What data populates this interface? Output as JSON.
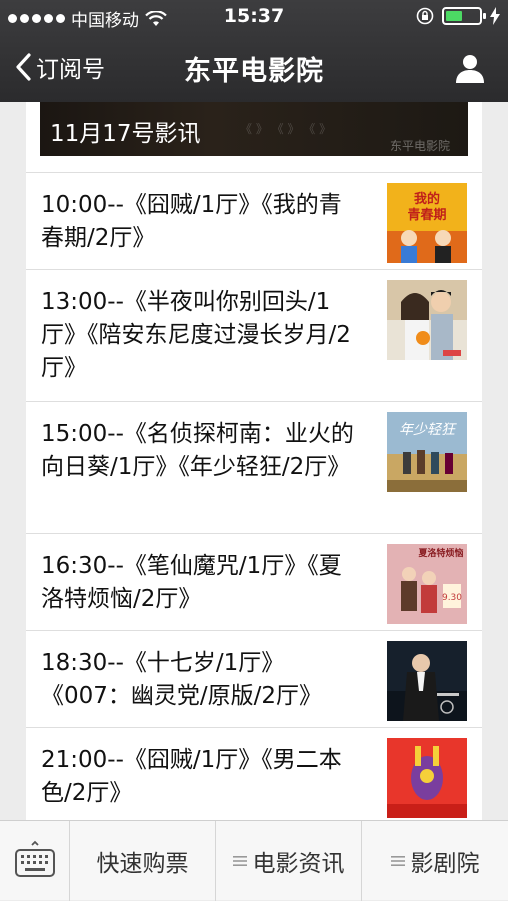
{
  "status_bar": {
    "carrier": "中国移动",
    "time": "15:37",
    "signal_icon": "signal-dots-icon",
    "wifi_icon": "wifi-icon",
    "battery_level": 0.5,
    "battery_color": "#4cd964"
  },
  "nav": {
    "back_label": "订阅号",
    "title": "东平电影院"
  },
  "banner": {
    "text": "11月17号影讯",
    "watermark": "东平电影院"
  },
  "schedule": [
    {
      "text": "10:00--《囧贼/1厅》《我的青春期/2厅》",
      "poster": "poster-youth"
    },
    {
      "text": "13:00--《半夜叫你别回头/1厅》《陪安东尼度过漫长岁月/2厅》",
      "poster": "poster-anthony"
    },
    {
      "text": "15:00--《名侦探柯南：业火的向日葵/1厅》《年少轻狂/2厅》",
      "poster": "poster-young"
    },
    {
      "text": "16:30--《笔仙魔咒/1厅》《夏洛特烦恼/2厅》",
      "poster": "poster-charlotte"
    },
    {
      "text": "18:30--《十七岁/1厅》《007：幽灵党/原版/2厅》",
      "poster": "poster-007"
    },
    {
      "text": "21:00--《囧贼/1厅》《男二本色/2厅》",
      "poster": "poster-mentwo"
    }
  ],
  "menu": {
    "keyboard_icon": "keyboard-icon",
    "items": [
      {
        "label": "快速购票",
        "has_submenu": false
      },
      {
        "label": "电影资讯",
        "has_submenu": true
      },
      {
        "label": "影剧院",
        "has_submenu": true
      }
    ]
  },
  "colors": {
    "nav_bg": "#2b2b2d",
    "page_bg": "#ececec",
    "card_bg": "#ffffff",
    "divider": "#dedede"
  }
}
